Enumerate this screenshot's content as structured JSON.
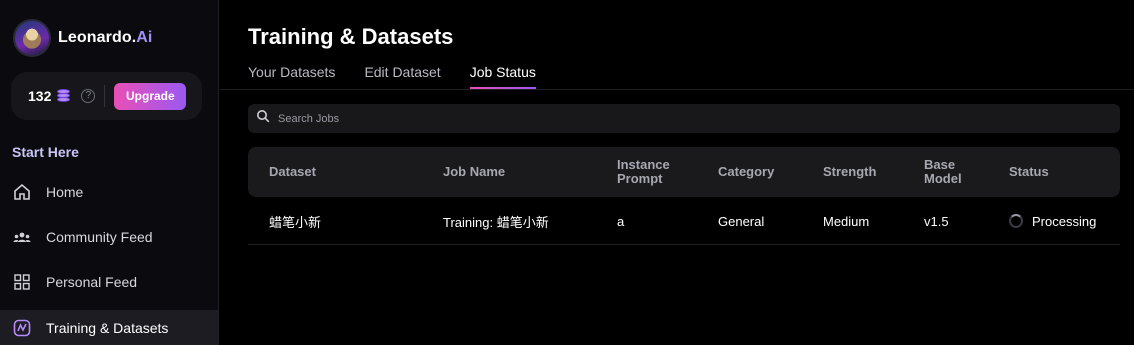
{
  "brand": {
    "name": "Leonardo.",
    "suffix": "Ai"
  },
  "credits": {
    "count": "132",
    "upgrade_label": "Upgrade",
    "help": "?"
  },
  "sidebar": {
    "section_label": "Start Here",
    "items": [
      {
        "label": "Home",
        "icon": "home-icon"
      },
      {
        "label": "Community Feed",
        "icon": "community-icon"
      },
      {
        "label": "Personal Feed",
        "icon": "grid-icon"
      },
      {
        "label": "Training & Datasets",
        "icon": "training-icon",
        "active": true
      }
    ]
  },
  "page": {
    "title": "Training & Datasets",
    "tabs": [
      {
        "label": "Your Datasets"
      },
      {
        "label": "Edit Dataset"
      },
      {
        "label": "Job Status",
        "active": true
      }
    ]
  },
  "search": {
    "placeholder": "Search Jobs"
  },
  "table": {
    "headers": [
      "Dataset",
      "Job Name",
      "Instance\nPrompt",
      "Category",
      "Strength",
      "Base\nModel",
      "Status"
    ],
    "rows": [
      {
        "dataset": "蜡笔小新",
        "job_name": "Training: 蜡笔小新",
        "instance_prompt": "a",
        "category": "General",
        "strength": "Medium",
        "base_model": "v1.5",
        "status": "Processing"
      }
    ]
  },
  "colors": {
    "accent_start": "#e84fb6",
    "accent_end": "#9b59f2",
    "brand_ai": "#a58df7"
  }
}
